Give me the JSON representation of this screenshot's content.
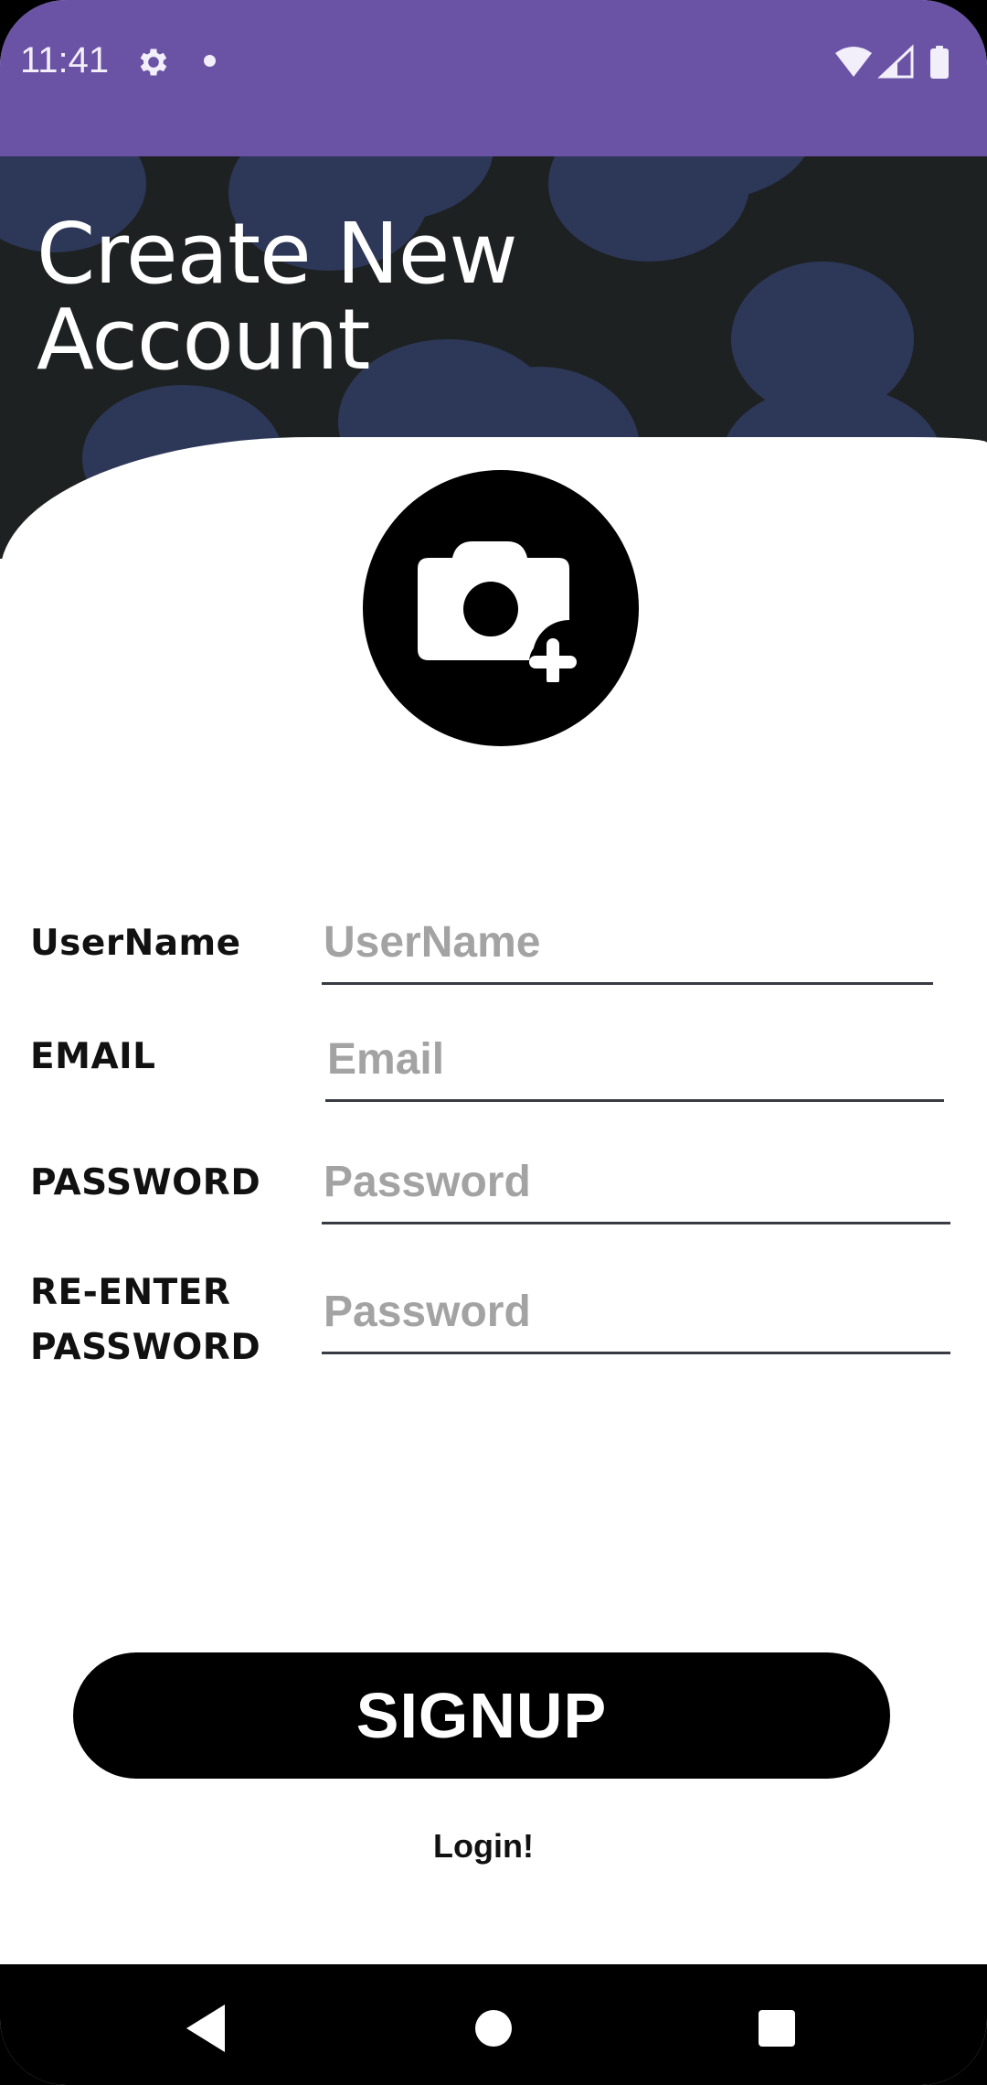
{
  "status_bar": {
    "time": "11:41",
    "icons": [
      "gear-icon",
      "notification-dot",
      "wifi-icon",
      "signal-icon",
      "battery-icon"
    ],
    "background": "#6a52a5"
  },
  "header": {
    "title_line1": "Create New",
    "title_line2": "Account",
    "background": "#1e2122",
    "pattern_color": "#2e3a5c"
  },
  "avatar": {
    "icon": "add-photo-camera-icon"
  },
  "form": {
    "username": {
      "label": "UserName",
      "placeholder": "UserName",
      "value": ""
    },
    "email": {
      "label": "EMAIL",
      "placeholder": "Email",
      "value": ""
    },
    "password": {
      "label": "PASSWORD",
      "placeholder": "Password",
      "value": ""
    },
    "reenter_password": {
      "label_line1": "RE-ENTER",
      "label_line2": "PASSWORD",
      "placeholder": "Password",
      "value": ""
    }
  },
  "actions": {
    "signup_label": "SIGNUP",
    "login_label": "Login!"
  },
  "nav_bar": {
    "buttons": [
      "back-icon",
      "home-icon",
      "recents-icon"
    ]
  }
}
